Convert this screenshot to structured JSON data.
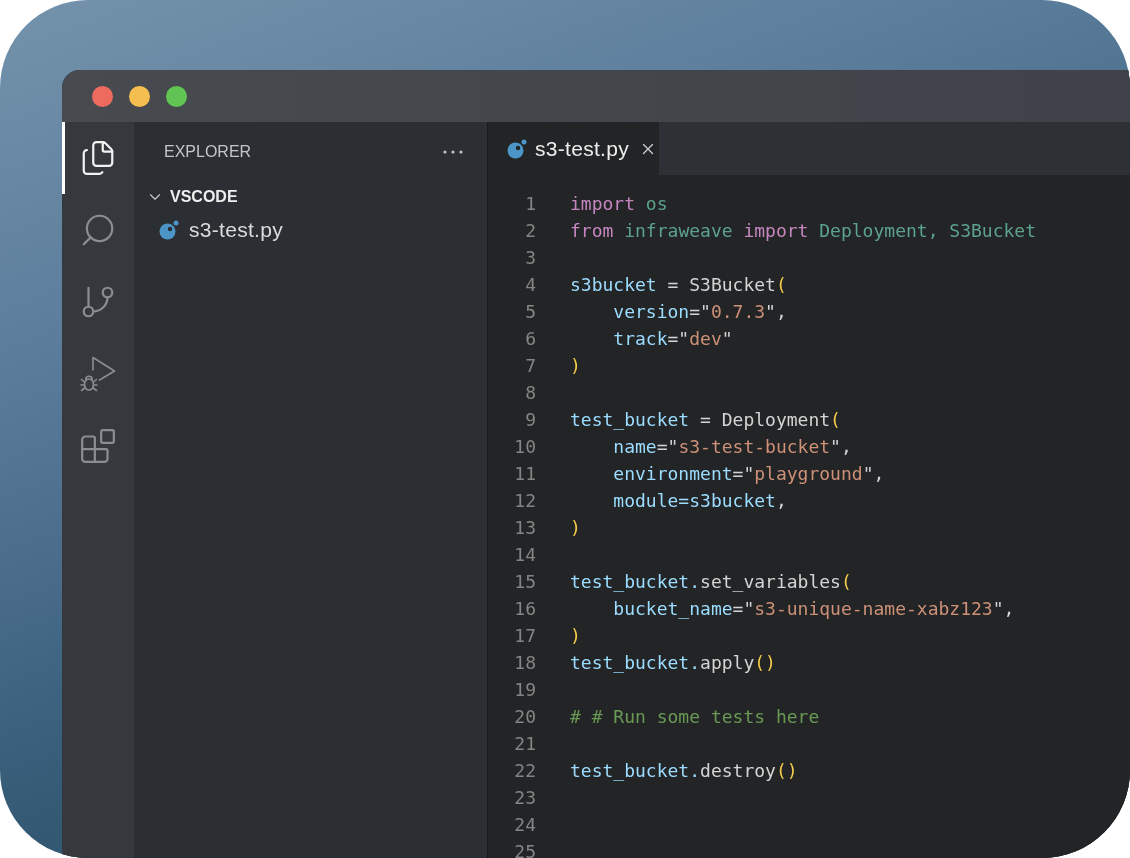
{
  "window": {
    "controls": [
      {
        "kind": "close"
      },
      {
        "kind": "minimize"
      },
      {
        "kind": "zoom"
      }
    ]
  },
  "activity_bar": {
    "items": [
      {
        "kind": "explorer",
        "selected": true
      },
      {
        "kind": "search",
        "selected": false
      },
      {
        "kind": "source_control",
        "selected": false
      },
      {
        "kind": "run_debug",
        "selected": false
      },
      {
        "kind": "extensions",
        "selected": false
      }
    ]
  },
  "sidebar": {
    "title": "EXPLORER",
    "folder": {
      "name": "VSCODE",
      "expanded": true,
      "files": [
        {
          "name": "s3-test.py"
        }
      ]
    }
  },
  "editor": {
    "tabs": [
      {
        "label": "s3-test.py",
        "selected": true
      }
    ],
    "lines": [
      {
        "number": "1",
        "tokens": [
          {
            "kind": "keyword",
            "text": "import"
          },
          {
            "kind": "module",
            "text": " os"
          }
        ]
      },
      {
        "number": "2",
        "tokens": [
          {
            "kind": "keyword",
            "text": "from"
          },
          {
            "kind": "module",
            "text": " infraweave "
          },
          {
            "kind": "keyword",
            "text": "import"
          },
          {
            "kind": "module",
            "text": " Deployment, S3Bucket"
          }
        ]
      },
      {
        "number": "3"
      },
      {
        "number": "4",
        "tokens": [
          {
            "kind": "variable",
            "text": "s3bucket"
          },
          {
            "kind": "plain",
            "text": " = S3Bucket"
          },
          {
            "kind": "bracket",
            "text": "("
          }
        ],
        "children": [
          {
            "number": "5",
            "tokens": [
              {
                "kind": "variable",
                "text": "version"
              },
              {
                "kind": "plain",
                "text": "=\""
              },
              {
                "kind": "string",
                "text": "0.7.3"
              },
              {
                "kind": "plain",
                "text": "\","
              }
            ]
          },
          {
            "number": "6",
            "tokens": [
              {
                "kind": "variable",
                "text": "track"
              },
              {
                "kind": "plain",
                "text": "=\""
              },
              {
                "kind": "string",
                "text": "dev"
              },
              {
                "kind": "plain",
                "text": "\""
              }
            ]
          }
        ]
      },
      {
        "number": "7",
        "tokens": [
          {
            "kind": "bracket",
            "text": ")"
          }
        ]
      },
      {
        "number": "8"
      },
      {
        "number": "9",
        "tokens": [
          {
            "kind": "variable",
            "text": "test_bucket"
          },
          {
            "kind": "plain",
            "text": " = Deployment"
          },
          {
            "kind": "bracket",
            "text": "("
          }
        ],
        "children": [
          {
            "number": "10",
            "tokens": [
              {
                "kind": "variable",
                "text": "name"
              },
              {
                "kind": "plain",
                "text": "=\""
              },
              {
                "kind": "string",
                "text": "s3-test-bucket"
              },
              {
                "kind": "plain",
                "text": "\","
              }
            ]
          },
          {
            "number": "11",
            "tokens": [
              {
                "kind": "variable",
                "text": "environment"
              },
              {
                "kind": "plain",
                "text": "=\""
              },
              {
                "kind": "string",
                "text": "playground"
              },
              {
                "kind": "plain",
                "text": "\","
              }
            ]
          },
          {
            "number": "12",
            "tokens": [
              {
                "kind": "variable",
                "text": "module=s3bucket"
              },
              {
                "kind": "plain",
                "text": ","
              }
            ]
          }
        ]
      },
      {
        "number": "13",
        "tokens": [
          {
            "kind": "bracket",
            "text": ")"
          }
        ]
      },
      {
        "number": "14"
      },
      {
        "number": "15",
        "tokens": [
          {
            "kind": "variable",
            "text": "test_bucket."
          },
          {
            "kind": "plain",
            "text": "set_variables"
          },
          {
            "kind": "bracket",
            "text": "("
          }
        ],
        "children": [
          {
            "number": "16",
            "tokens": [
              {
                "kind": "variable",
                "text": "bucket_name"
              },
              {
                "kind": "plain",
                "text": "=\""
              },
              {
                "kind": "string",
                "text": "s3-unique-name-xabz123"
              },
              {
                "kind": "plain",
                "text": "\","
              }
            ]
          }
        ]
      },
      {
        "number": "17",
        "tokens": [
          {
            "kind": "bracket",
            "text": ")"
          }
        ]
      },
      {
        "number": "18",
        "tokens": [
          {
            "kind": "variable",
            "text": "test_bucket."
          },
          {
            "kind": "plain",
            "text": "apply"
          },
          {
            "kind": "bracket",
            "text": "()"
          }
        ]
      },
      {
        "number": "19"
      },
      {
        "number": "20",
        "tokens": [
          {
            "kind": "comment",
            "text": "# # Run some tests here"
          }
        ]
      },
      {
        "number": "21"
      },
      {
        "number": "22",
        "tokens": [
          {
            "kind": "variable",
            "text": "test_bucket."
          },
          {
            "kind": "plain",
            "text": "destroy"
          },
          {
            "kind": "bracket",
            "text": "()"
          }
        ]
      },
      {
        "number": "23"
      },
      {
        "number": "24"
      },
      {
        "number": "25"
      }
    ]
  }
}
